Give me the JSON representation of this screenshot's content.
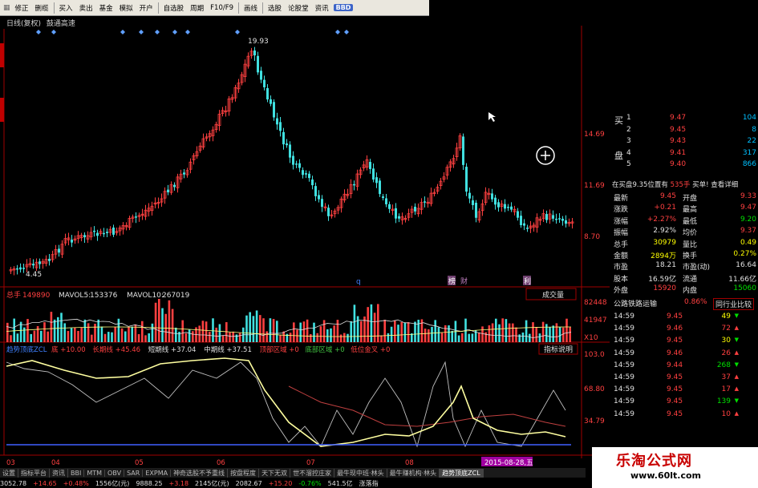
{
  "toolbar": {
    "items": [
      "修正",
      "删缆",
      "买入",
      "卖出",
      "基金",
      "模拟",
      "开户",
      "自选股",
      "周期",
      "F10/F9",
      "画线",
      "选股",
      "论股堂",
      "资讯"
    ],
    "badge": "BBD"
  },
  "chart_title": {
    "mode": "日线(复权)",
    "name": "鼓通高速"
  },
  "price_axis": {
    "labels": [
      "14.69",
      "11.69",
      "8.70"
    ],
    "high_label": "19.93",
    "low_label": "4.45"
  },
  "kline_markers": {
    "q": "q",
    "m": "榜",
    "c": "财",
    "r": "利"
  },
  "volume_bar": {
    "label": "总手",
    "value": "149890",
    "ma5_label": "MAVOL5:",
    "ma5_value": "153376",
    "ma10_label": "MAVOL10:",
    "ma10_value": "267019",
    "axis": [
      "82448",
      "41947",
      "X10"
    ],
    "button": "成交量"
  },
  "indicator_bar": {
    "name": "趋势顶底ZCL",
    "items": [
      {
        "label": "底",
        "value": "+10.00",
        "color": "#ff4040"
      },
      {
        "label": "长期线",
        "value": "+45.46",
        "color": "#ff4040"
      },
      {
        "label": "短期线",
        "value": "+37.04",
        "color": "#e0e0e0"
      },
      {
        "label": "中期线",
        "value": "+37.51",
        "color": "#e0e0e0"
      },
      {
        "label": "顶部区域",
        "value": "+0",
        "color": "#ff4040"
      },
      {
        "label": "底部区域",
        "value": "+0",
        "color": "#40c040"
      },
      {
        "label": "低位金叉",
        "value": "+0",
        "color": "#ff4040"
      }
    ],
    "axis": [
      "103.0",
      "68.80",
      "34.79"
    ],
    "button": "指标说明"
  },
  "time_axis": {
    "labels": [
      "03",
      "04",
      "05",
      "06",
      "07",
      "08"
    ],
    "highlight": "2015-08-28,五"
  },
  "order_book": {
    "side_sell": "买",
    "side_buy": "盘",
    "rows": [
      {
        "level": "1",
        "price": "9.47",
        "vol": "104"
      },
      {
        "level": "2",
        "price": "9.45",
        "vol": "8"
      },
      {
        "level": "3",
        "price": "9.43",
        "vol": "22"
      },
      {
        "level": "4",
        "price": "9.41",
        "vol": "317"
      },
      {
        "level": "5",
        "price": "9.40",
        "vol": "866"
      }
    ],
    "info_left": "在买盘9.35位置有",
    "info_mid": "535手",
    "info_right": "买单! 查看详细"
  },
  "quote": [
    {
      "l": "最新",
      "v": "9.45",
      "l2": "开盘",
      "v2": "9.33",
      "c1": "#ff4040",
      "c2": "#ff4040"
    },
    {
      "l": "涨跌",
      "v": "+0.21",
      "l2": "最高",
      "v2": "9.47",
      "c1": "#ff4040",
      "c2": "#ff4040"
    },
    {
      "l": "涨幅",
      "v": "+2.27%",
      "l2": "最低",
      "v2": "9.20",
      "c1": "#ff4040",
      "c2": "#00e000"
    },
    {
      "l": "振幅",
      "v": "2.92%",
      "l2": "均价",
      "v2": "9.37",
      "c1": "#e0e0e0",
      "c2": "#ff4040"
    },
    {
      "l": "总手",
      "v": "30979",
      "l2": "量比",
      "v2": "0.49",
      "c1": "#ffff00",
      "c2": "#ffff00"
    },
    {
      "l": "金额",
      "v": "2894万",
      "l2": "换手",
      "v2": "0.27%",
      "c1": "#ffff00",
      "c2": "#ffff00"
    },
    {
      "l": "市盈",
      "v": "18.21",
      "l2": "市盈(动)",
      "v2": "16.64",
      "c1": "#e0e0e0",
      "c2": "#e0e0e0"
    },
    {
      "l": "股本",
      "v": "16.59亿",
      "l2": "流通",
      "v2": "11.66亿",
      "c1": "#e0e0e0",
      "c2": "#e0e0e0"
    },
    {
      "l": "外盘",
      "v": "15920",
      "l2": "内盘",
      "v2": "15060",
      "c1": "#ff4040",
      "c2": "#00e000"
    }
  ],
  "sector": {
    "name": "公路铁路运输",
    "change": "0.86%",
    "button": "同行业比较"
  },
  "ticks": [
    {
      "t": "14:59",
      "p": "9.45",
      "v": "49",
      "c": "#ff4040",
      "vc": "#ffff00",
      "up": false
    },
    {
      "t": "14:59",
      "p": "9.46",
      "v": "72",
      "c": "#ff4040",
      "vc": "#ff4040",
      "up": true
    },
    {
      "t": "14:59",
      "p": "9.45",
      "v": "30",
      "c": "#ff4040",
      "vc": "#ffff00",
      "up": false
    },
    {
      "t": "14:59",
      "p": "9.46",
      "v": "26",
      "c": "#ff4040",
      "vc": "#ff4040",
      "up": true
    },
    {
      "t": "14:59",
      "p": "9.44",
      "v": "268",
      "c": "#ff4040",
      "vc": "#00e000",
      "up": false
    },
    {
      "t": "14:59",
      "p": "9.45",
      "v": "37",
      "c": "#ff4040",
      "vc": "#ff4040",
      "up": true
    },
    {
      "t": "14:59",
      "p": "9.45",
      "v": "17",
      "c": "#ff4040",
      "vc": "#ff4040",
      "up": true
    },
    {
      "t": "14:59",
      "p": "9.45",
      "v": "139",
      "c": "#ff4040",
      "vc": "#00e000",
      "up": false
    },
    {
      "t": "14:59",
      "p": "9.45",
      "v": "10",
      "c": "#ff4040",
      "vc": "#ff4040",
      "up": true
    }
  ],
  "bottom_tabs": [
    "设置",
    "指标平台",
    "资讯",
    "BBI",
    "MTM",
    "OBV",
    "SAR",
    "EXPMA",
    "神奇选股不予重线",
    "按盘程度",
    "天下无双",
    "世不溜控庄家",
    "最牛现中班·林头",
    "最牛赚机构·林头",
    "趋势顶底ZCL"
  ],
  "status": [
    "3052.78",
    "+14.65",
    "+0.48%",
    "1556亿(元)",
    "9888.25",
    "+3.18",
    "2145亿(元)",
    "2082.67",
    "+15.20",
    "-0.76%",
    "541.5亿",
    "涨落指"
  ],
  "watermark": {
    "title": "乐淘公式网",
    "url": "www.60lt.com"
  },
  "colors": {
    "up": "#ff4040",
    "down": "#40e0e0",
    "accent": "#4080ff",
    "ma_white": "#ffffc0"
  }
}
